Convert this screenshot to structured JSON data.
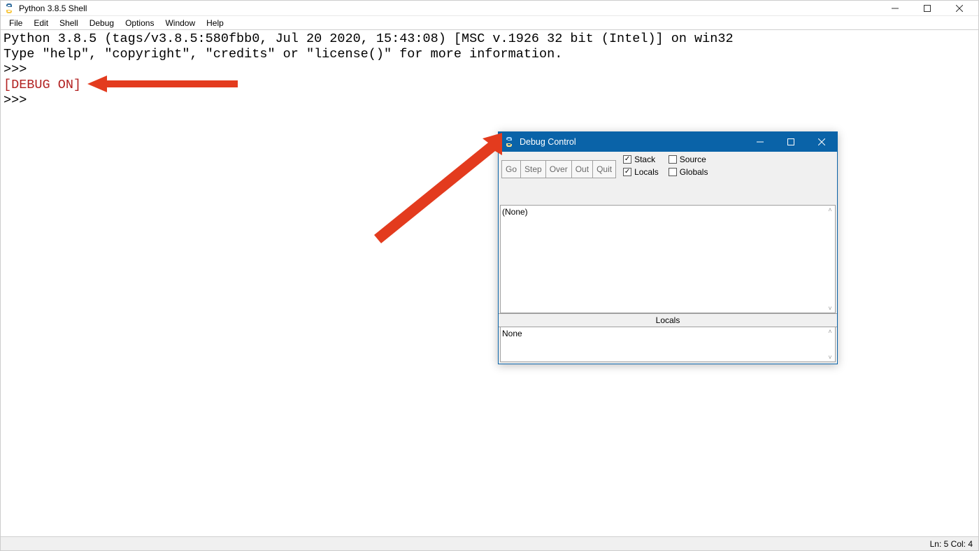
{
  "idle": {
    "title": "Python 3.8.5 Shell",
    "menu": [
      "File",
      "Edit",
      "Shell",
      "Debug",
      "Options",
      "Window",
      "Help"
    ],
    "banner_line1": "Python 3.8.5 (tags/v3.8.5:580fbb0, Jul 20 2020, 15:43:08) [MSC v.1926 32 bit (Intel)] on win32",
    "banner_line2": "Type \"help\", \"copyright\", \"credits\" or \"license()\" for more information.",
    "prompt": ">>> ",
    "debug_on": "[DEBUG ON]",
    "status": "Ln: 5   Col: 4"
  },
  "debug": {
    "title": "Debug Control",
    "buttons": {
      "go": "Go",
      "step": "Step",
      "over": "Over",
      "out": "Out",
      "quit": "Quit"
    },
    "checks": {
      "stack": "Stack",
      "source": "Source",
      "locals": "Locals",
      "globals": "Globals"
    },
    "stack_content": "(None)",
    "locals_header": "Locals",
    "locals_content": "None"
  }
}
